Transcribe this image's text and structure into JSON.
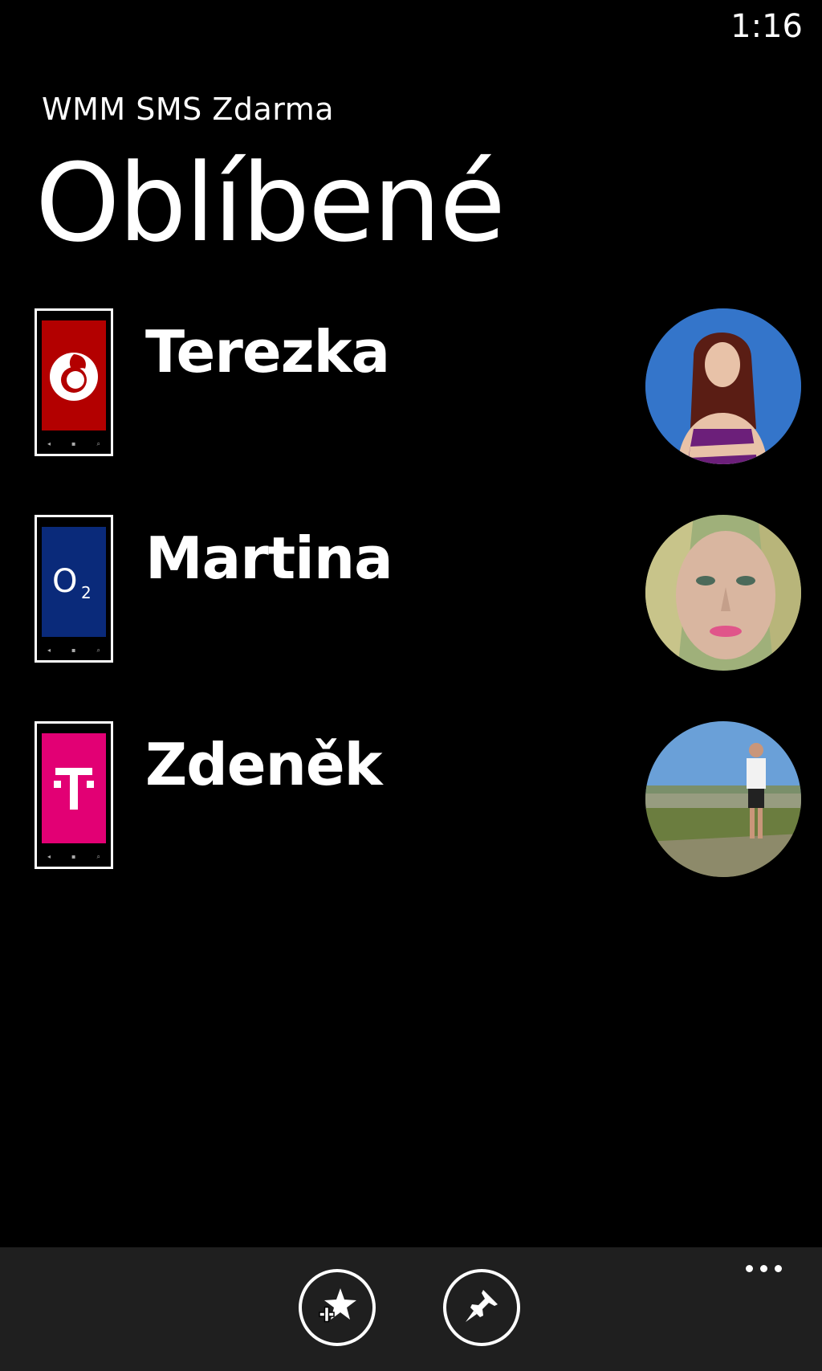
{
  "status_bar": {
    "time": "1:16"
  },
  "app": {
    "title": "WMM SMS Zdarma",
    "page_title": "Oblíbené"
  },
  "contacts": [
    {
      "name": "Terezka",
      "operator": "Vodafone",
      "operator_color": "#b30000",
      "operator_icon": "vodafone-logo-icon",
      "avatar_icon": "avatar-photo-terezka"
    },
    {
      "name": "Martina",
      "operator": "O2",
      "operator_color": "#0a2a7a",
      "operator_icon": "o2-logo-icon",
      "avatar_icon": "avatar-photo-martina"
    },
    {
      "name": "Zdeněk",
      "operator": "T-Mobile",
      "operator_color": "#e20074",
      "operator_icon": "tmobile-logo-icon",
      "avatar_icon": "avatar-photo-zdenek"
    }
  ],
  "app_bar": {
    "buttons": [
      {
        "icon": "add-favorite-icon"
      },
      {
        "icon": "pin-icon"
      }
    ],
    "more_icon": "more-dots-icon"
  },
  "colors": {
    "background": "#000000",
    "app_bar": "#1f1f1f",
    "text": "#ffffff"
  }
}
